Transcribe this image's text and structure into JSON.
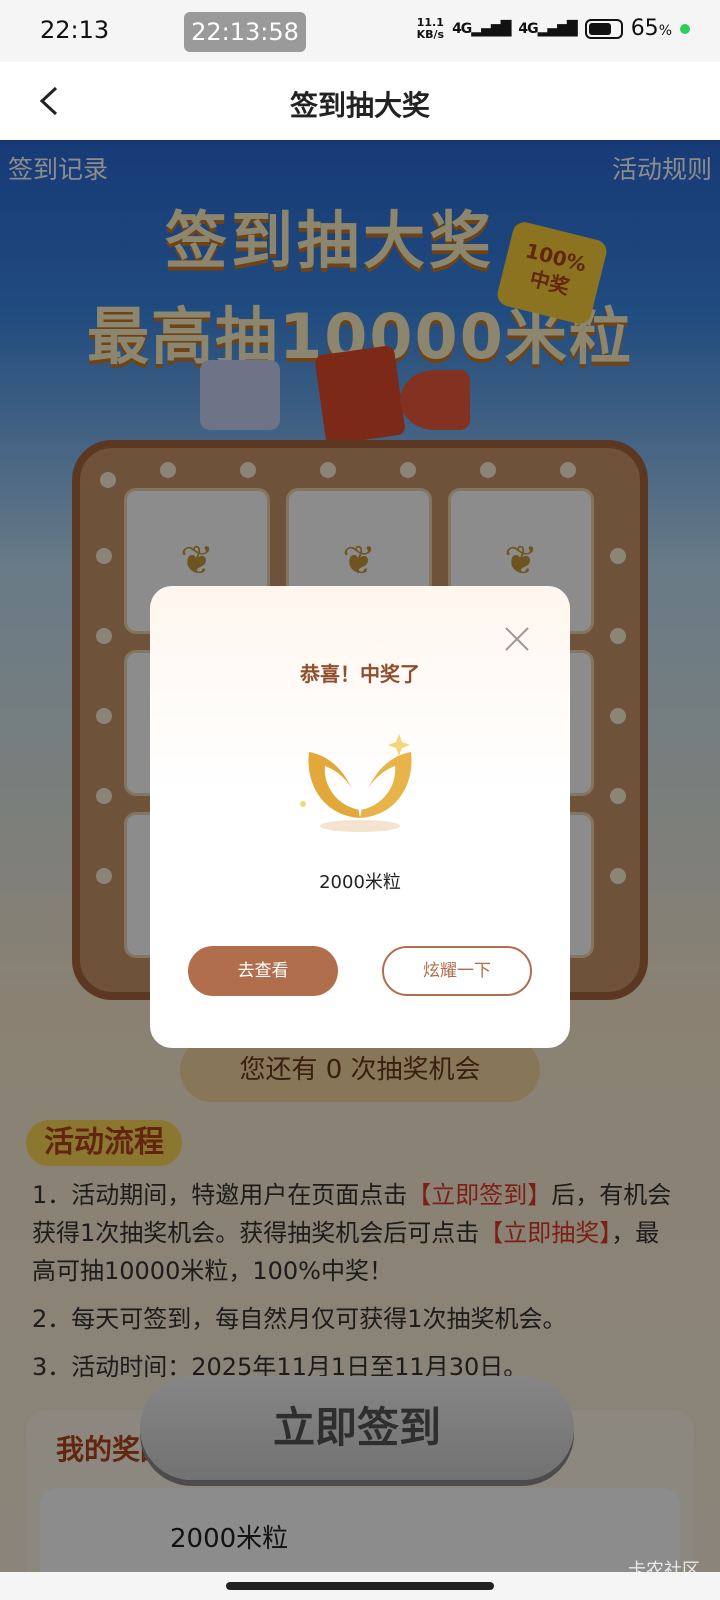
{
  "status_bar": {
    "time": "22:13",
    "screen_recording_timer": "22:13:58",
    "net_speed_value": "11.1",
    "net_speed_unit": "KB/s",
    "signal1": "4G",
    "signal2": "4G",
    "battery": "65",
    "battery_unit": "%"
  },
  "header": {
    "title": "签到抽大奖"
  },
  "page": {
    "sign_record_link": "签到记录",
    "rules_link": "活动规则",
    "banner_line1": "签到抽大奖",
    "banner_line2": "最高抽10000米粒",
    "badge_line1": "100%",
    "badge_line2": "中奖",
    "chances_text": "您还有 0 次抽奖机会",
    "section_title": "活动流程",
    "rules": {
      "r1_a": "1．活动期间，特邀用户在页面点击",
      "r1_hl1": "【立即签到】",
      "r1_b": "后，有机会获得1次抽奖机会。获得抽奖机会后可点击",
      "r1_hl2": "【立即抽奖】",
      "r1_c": "，最高可抽10000米粒，100%中奖！",
      "r2": "2．每天可签到，每自然月仅可获得1次抽奖机会。",
      "r3": "3．活动时间：2025年11月1日至11月30日。"
    },
    "my_prize_title": "我的奖品",
    "my_prize_value": "2000米粒",
    "sign_button": "立即签到"
  },
  "modal": {
    "title": "恭喜！中奖了",
    "prize_text": "2000米粒",
    "view_button": "去查看",
    "share_button": "炫耀一下",
    "prize_icon": "rice-leaf-icon"
  },
  "watermark": "卡农社区",
  "colors": {
    "accent_brown": "#b06e4d",
    "title_brown": "#8e4f2c",
    "highlight_red": "#e23a2a"
  }
}
